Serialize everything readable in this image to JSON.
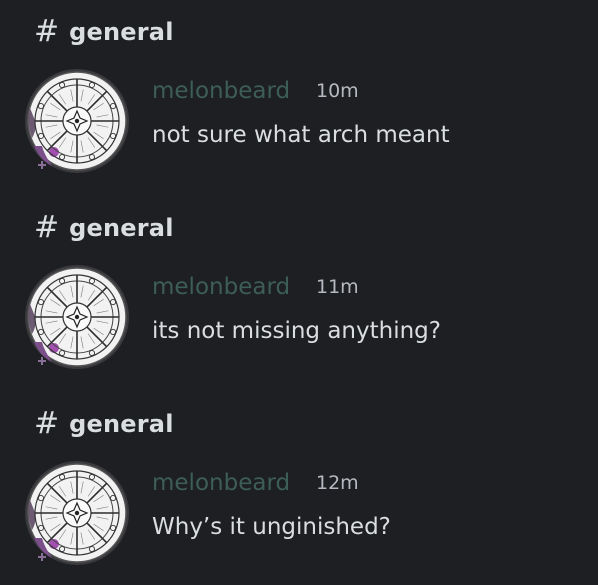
{
  "messages": [
    {
      "channel": "general",
      "username": "melonbeard",
      "time": "10m",
      "text": "not sure what arch meant"
    },
    {
      "channel": "general",
      "username": "melonbeard",
      "time": "11m",
      "text": "its not missing anything?"
    },
    {
      "channel": "general",
      "username": "melonbeard",
      "time": "12m",
      "text": "Why’s it unginished?"
    }
  ],
  "icons": {
    "channel": "hash-icon",
    "avatar": "occult-wheel-avatar"
  },
  "colors": {
    "background": "#1e1f22",
    "username": "#3d5d57",
    "text": "#dbdee1",
    "timestamp": "#b5bac1"
  }
}
